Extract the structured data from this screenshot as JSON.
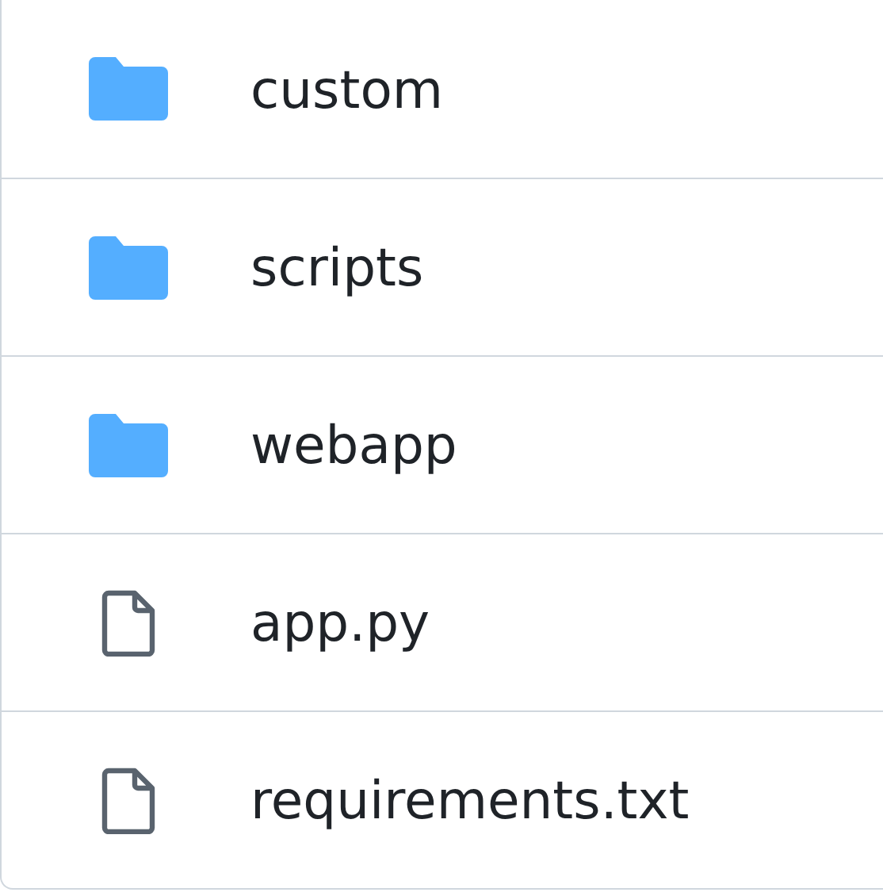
{
  "files": [
    {
      "kind": "folder",
      "name": "custom"
    },
    {
      "kind": "folder",
      "name": "scripts"
    },
    {
      "kind": "folder",
      "name": "webapp"
    },
    {
      "kind": "file",
      "name": "app.py"
    },
    {
      "kind": "file",
      "name": "requirements.txt"
    }
  ]
}
